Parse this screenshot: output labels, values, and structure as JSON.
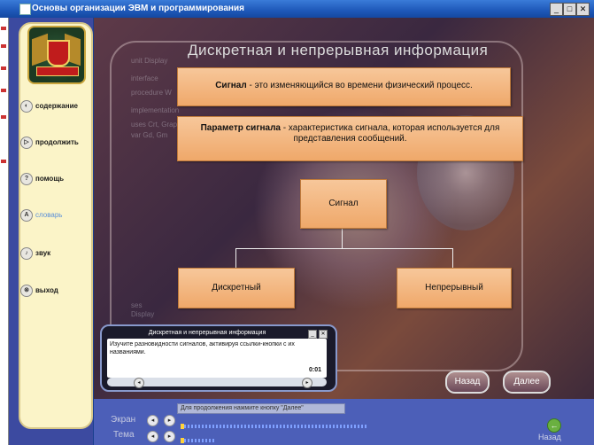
{
  "window": {
    "title": "Основы организации ЭВМ и программирования",
    "controls": [
      "_",
      "□",
      "✕"
    ]
  },
  "sidebar": {
    "items": [
      {
        "label": "содержание",
        "icon": "book-icon",
        "glyph": "◐"
      },
      {
        "label": "продолжить",
        "icon": "continue-icon",
        "glyph": "▷"
      },
      {
        "label": "помощь",
        "icon": "help-icon",
        "glyph": "?"
      },
      {
        "label": "словарь",
        "icon": "dictionary-icon",
        "glyph": "A"
      },
      {
        "label": "звук",
        "icon": "sound-icon",
        "glyph": "♪"
      },
      {
        "label": "выход",
        "icon": "exit-icon",
        "glyph": "⊗"
      }
    ]
  },
  "slide": {
    "title": "Дискретная и непрерывная информация",
    "definition1": {
      "term": "Сигнал",
      "text": " - это изменяющийся во времени физический процесс."
    },
    "definition2": {
      "term": "Параметр сигнала",
      "text": " - характеристика сигнала, которая используется для представления сообщений."
    },
    "diagram": {
      "root": "Сигнал",
      "children": [
        "Дискретный",
        "Непрерывный"
      ]
    },
    "watermark": [
      "unit Display",
      "interface",
      "procedure W",
      "implementation",
      "uses Crt, Grap",
      "var Gd, Gm",
      "ses",
      "Display"
    ]
  },
  "popup": {
    "title": "Дискретная и непрерывная информация",
    "text": "Изучите разновидности сигналов, активируя ссылки-кнопки с их названиями.",
    "time": "0:01"
  },
  "nav": {
    "back": "Назад",
    "next": "Далее"
  },
  "footer": {
    "hint": "Для продолжения нажмите кнопку \"Далее\"",
    "screen_label": "Экран",
    "topic_label": "Тема",
    "back_label": "Назад"
  }
}
